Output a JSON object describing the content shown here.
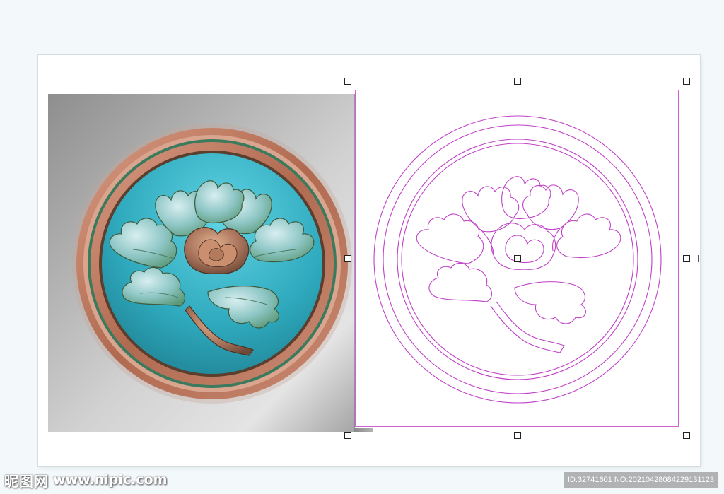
{
  "watermark": {
    "logo_text": "昵图网",
    "url_text": "www.nipic.com",
    "id_text": "ID:32741601 NO:20210428084229131123"
  },
  "artwork": {
    "relief_subject": "peony-flower-carving",
    "vector_subject": "peony-flower-outline",
    "colors": {
      "relief_background": "#b4b4b4",
      "relief_disc": "#3ab8cc",
      "relief_rim": "#c9826a",
      "relief_petal": "#8fc4c0",
      "relief_petal_shadow": "#a06a4e",
      "vector_stroke": "#c040c8",
      "selection_frame": "#d060d0"
    }
  },
  "selection": {
    "handle_icon": "resize-handle-square"
  }
}
